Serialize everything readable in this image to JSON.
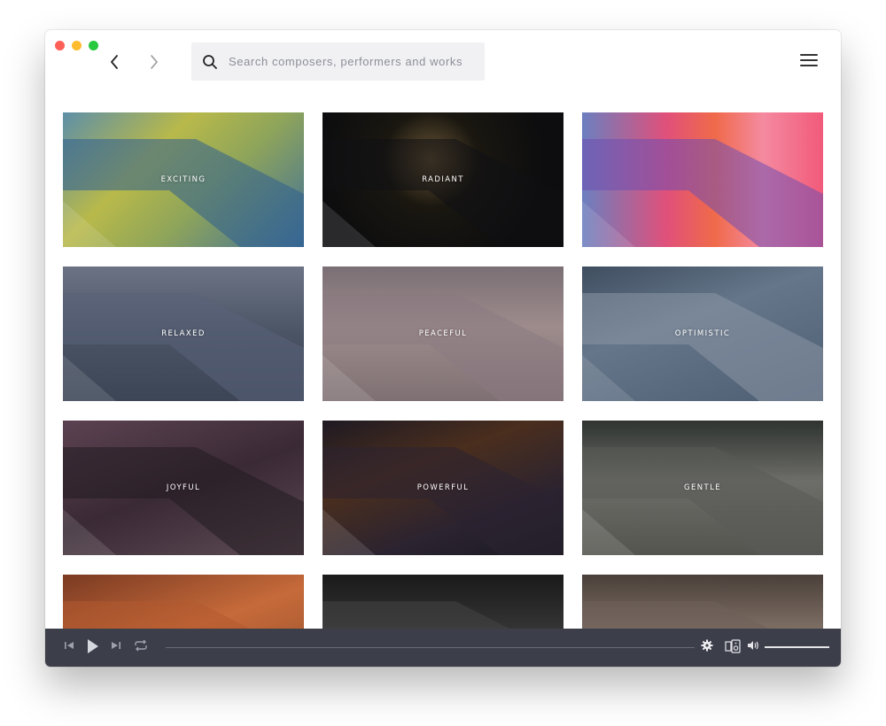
{
  "search": {
    "placeholder": "Search composers, performers and works"
  },
  "moods": [
    {
      "label": "EXCITING",
      "bg": "linear-gradient(135deg,#5d8fa8 0%,#b8b94a 35%,#8fa55a 60%,#3f6f9a 100%)",
      "overlay": "#2f5f8f"
    },
    {
      "label": "RADIANT",
      "bg": "radial-gradient(circle at 45% 35%, #6a5636 0%, #1a1710 30%, #0d0d0f 70%)",
      "overlay": "#111114"
    },
    {
      "label": "",
      "bg": "linear-gradient(90deg,#6b7fc0 0%,#e0507a 35%,#f06a4a 55%,#f48aa0 75%,#f25a7a 100%)",
      "overlay": "#6f4fb0"
    },
    {
      "label": "RELAXED",
      "bg": "linear-gradient(180deg,#6c7384 0%,#4a5465 50%,#3b4555 100%)",
      "overlay": "#59627a"
    },
    {
      "label": "PEACEFUL",
      "bg": "linear-gradient(180deg,#7a6f75 0%,#9e8c8c 45%,#7e7073 100%)",
      "overlay": "#8b7a82"
    },
    {
      "label": "OPTIMISTIC",
      "bg": "linear-gradient(160deg,#3f4e5f 0%,#65768a 40%,#4d5e72 100%)",
      "overlay": "#8a96a6"
    },
    {
      "label": "JOYFUL",
      "bg": "linear-gradient(160deg,#5c4252 0%,#3a2a35 50%,#5e4b55 100%)",
      "overlay": "#231b20"
    },
    {
      "label": "POWERFUL",
      "bg": "linear-gradient(160deg,#1e1a22 0%,#4a2e1e 35%,#2b2330 70%,#1a1a22 100%)",
      "overlay": "#2c2231"
    },
    {
      "label": "GENTLE",
      "bg": "linear-gradient(180deg,#2f3430 0%,#6d6d69 45%,#55554f 100%)",
      "overlay": "#5a5b57"
    },
    {
      "label": "",
      "bg": "linear-gradient(160deg,#7a3a22 0%,#c66a3a 45%,#8a4a2a 100%)",
      "overlay": "#b35a30"
    },
    {
      "label": "",
      "bg": "linear-gradient(180deg,#1a1a1a 0%,#3a3a3a 50%,#222 100%)",
      "overlay": "#444"
    },
    {
      "label": "",
      "bg": "linear-gradient(180deg,#4a3f3a 0%,#8a7a6e 50%,#5a4e48 100%)",
      "overlay": "#6d605a"
    }
  ],
  "colors": {
    "player_bg": "#3c3e4a",
    "accent": "#ffffff"
  }
}
